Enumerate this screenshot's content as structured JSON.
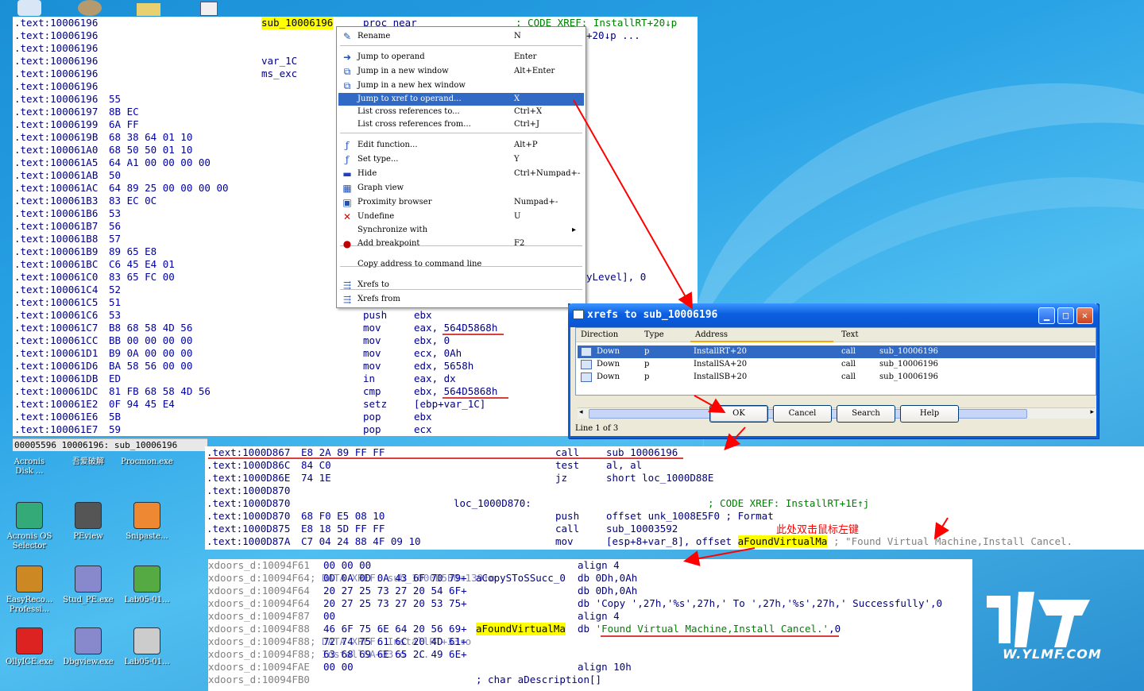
{
  "ida_view1": {
    "rows": [
      {
        "addr": ".text:10006196",
        "bytes": "",
        "label": "sub_10006196",
        "mnem": "proc near",
        "op": "; CODE XREF: InstallRT+20↓p"
      },
      {
        "addr": ".text:10006196",
        "bytes": "",
        "label": "",
        "mnem": "",
        "op": "+20↓p ..."
      },
      {
        "addr": ".text:10006196",
        "bytes": "",
        "label": "",
        "mnem": "",
        "op": ""
      },
      {
        "addr": ".text:10006196",
        "bytes": "",
        "label": "var_1C",
        "mnem": "",
        "op": ""
      },
      {
        "addr": ".text:10006196",
        "bytes": "",
        "label": "ms_exc",
        "mnem": "",
        "op": ""
      },
      {
        "addr": ".text:10006196",
        "bytes": "",
        "label": "",
        "mnem": "",
        "op": ""
      },
      {
        "addr": ".text:10006196",
        "bytes": "55",
        "label": "",
        "mnem": "",
        "op": ""
      },
      {
        "addr": ".text:10006197",
        "bytes": "8B EC",
        "label": "",
        "mnem": "",
        "op": ""
      },
      {
        "addr": ".text:10006199",
        "bytes": "6A FF",
        "label": "",
        "mnem": "",
        "op": ""
      },
      {
        "addr": ".text:1000619B",
        "bytes": "68 38 64 01 10",
        "label": "",
        "mnem": "",
        "op": ""
      },
      {
        "addr": ".text:100061A0",
        "bytes": "68 50 50 01 10",
        "label": "",
        "mnem": "",
        "op": ""
      },
      {
        "addr": ".text:100061A5",
        "bytes": "64 A1 00 00 00 00",
        "label": "",
        "mnem": "",
        "op": ""
      },
      {
        "addr": ".text:100061AB",
        "bytes": "50",
        "label": "",
        "mnem": "",
        "op": ""
      },
      {
        "addr": ".text:100061AC",
        "bytes": "64 89 25 00 00 00 00",
        "label": "",
        "mnem": "",
        "op": ""
      },
      {
        "addr": ".text:100061B3",
        "bytes": "83 EC 0C",
        "label": "",
        "mnem": "",
        "op": ""
      },
      {
        "addr": ".text:100061B6",
        "bytes": "53",
        "label": "",
        "mnem": "",
        "op": ""
      },
      {
        "addr": ".text:100061B7",
        "bytes": "56",
        "label": "",
        "mnem": "",
        "op": ""
      },
      {
        "addr": ".text:100061B8",
        "bytes": "57",
        "label": "",
        "mnem": "",
        "op": ""
      },
      {
        "addr": ".text:100061B9",
        "bytes": "89 65 E8",
        "label": "",
        "mnem": "",
        "op": ""
      },
      {
        "addr": ".text:100061BC",
        "bytes": "C6 45 E4 01",
        "label": "",
        "mnem": "",
        "op": ""
      },
      {
        "addr": ".text:100061C0",
        "bytes": "83 65 FC 00",
        "label": "",
        "mnem": "",
        "op": "yLevel], 0"
      },
      {
        "addr": ".text:100061C4",
        "bytes": "52",
        "label": "",
        "mnem": "",
        "op": ""
      },
      {
        "addr": ".text:100061C5",
        "bytes": "51",
        "label": "",
        "mnem": "",
        "op": ""
      },
      {
        "addr": ".text:100061C6",
        "bytes": "53",
        "label": "",
        "mnem": "push",
        "op": "ebx"
      },
      {
        "addr": ".text:100061C7",
        "bytes": "B8 68 58 4D 56",
        "label": "",
        "mnem": "mov",
        "op": "eax, 564D5868h"
      },
      {
        "addr": ".text:100061CC",
        "bytes": "BB 00 00 00 00",
        "label": "",
        "mnem": "mov",
        "op": "ebx, 0"
      },
      {
        "addr": ".text:100061D1",
        "bytes": "B9 0A 00 00 00",
        "label": "",
        "mnem": "mov",
        "op": "ecx, 0Ah"
      },
      {
        "addr": ".text:100061D6",
        "bytes": "BA 58 56 00 00",
        "label": "",
        "mnem": "mov",
        "op": "edx, 5658h"
      },
      {
        "addr": ".text:100061DB",
        "bytes": "ED",
        "label": "",
        "mnem": "in",
        "op": "eax, dx"
      },
      {
        "addr": ".text:100061DC",
        "bytes": "81 FB 68 58 4D 56",
        "label": "",
        "mnem": "cmp",
        "op": "ebx, 564D5868h"
      },
      {
        "addr": ".text:100061E2",
        "bytes": "0F 94 45 E4",
        "label": "",
        "mnem": "setz",
        "op": "[ebp+var_1C]"
      },
      {
        "addr": ".text:100061E6",
        "bytes": "5B",
        "label": "",
        "mnem": "pop",
        "op": "ebx"
      },
      {
        "addr": ".text:100061E7",
        "bytes": "59",
        "label": "",
        "mnem": "pop",
        "op": "ecx"
      }
    ],
    "status": "00005596 10006196: sub_10006196"
  },
  "context_menu": {
    "items": [
      {
        "label": "Rename",
        "key": "N",
        "icon": "rename-icon"
      },
      {
        "label": "Jump to operand",
        "key": "Enter",
        "icon": "jump-icon"
      },
      {
        "label": "Jump in a new window",
        "key": "Alt+Enter",
        "icon": "new-window-icon"
      },
      {
        "label": "Jump in a new hex window",
        "key": "",
        "icon": "hex-window-icon"
      },
      {
        "label": "Jump to xref to operand...",
        "key": "X",
        "icon": "",
        "selected": true
      },
      {
        "label": "List cross references to...",
        "key": "Ctrl+X",
        "icon": ""
      },
      {
        "label": "List cross references from...",
        "key": "Ctrl+J",
        "icon": ""
      },
      {
        "label": "Edit function...",
        "key": "Alt+P",
        "icon": "function-icon"
      },
      {
        "label": "Set type...",
        "key": "Y",
        "icon": "type-icon"
      },
      {
        "label": "Hide",
        "key": "Ctrl+Numpad+-",
        "icon": "hide-icon"
      },
      {
        "label": "Graph view",
        "key": "",
        "icon": "graph-icon"
      },
      {
        "label": "Proximity browser",
        "key": "Numpad+-",
        "icon": "proximity-icon"
      },
      {
        "label": "Undefine",
        "key": "U",
        "icon": "undefine-icon"
      },
      {
        "label": "Synchronize with",
        "key": "▸",
        "icon": ""
      },
      {
        "label": "Add breakpoint",
        "key": "F2",
        "icon": "breakpoint-icon"
      },
      {
        "label": "Copy address to command line",
        "key": "",
        "icon": ""
      },
      {
        "label": "Xrefs to",
        "key": "",
        "icon": "xrefs-to-icon"
      },
      {
        "label": "Xrefs from",
        "key": "",
        "icon": "xrefs-from-icon"
      }
    ]
  },
  "xrefs_dialog": {
    "title": "xrefs to sub_10006196",
    "columns": [
      "Direction",
      "Type",
      "Address",
      "Text"
    ],
    "rows": [
      {
        "direction": "Down",
        "type": "p",
        "address": "InstallRT+20",
        "text1": "call",
        "text2": "sub_10006196"
      },
      {
        "direction": "Down",
        "type": "p",
        "address": "InstallSA+20",
        "text1": "call",
        "text2": "sub_10006196"
      },
      {
        "direction": "Down",
        "type": "p",
        "address": "InstallSB+20",
        "text1": "call",
        "text2": "sub_10006196"
      }
    ],
    "buttons": {
      "ok": "OK",
      "cancel": "Cancel",
      "search": "Search",
      "help": "Help"
    },
    "status": "Line 1 of 3"
  },
  "ida_view2": {
    "rows": [
      {
        "addr": ".text:1000D867",
        "bytes": "E8 2A 89 FF FF",
        "label": "",
        "mnem": "call",
        "op": "sub_10006196",
        "comment": ""
      },
      {
        "addr": ".text:1000D86C",
        "bytes": "84 C0",
        "label": "",
        "mnem": "test",
        "op": "al, al",
        "comment": ""
      },
      {
        "addr": ".text:1000D86E",
        "bytes": "74 1E",
        "label": "",
        "mnem": "jz",
        "op": "short loc_1000D88E",
        "comment": ""
      },
      {
        "addr": ".text:1000D870",
        "bytes": "",
        "label": "",
        "mnem": "",
        "op": "",
        "comment": ""
      },
      {
        "addr": ".text:1000D870",
        "bytes": "",
        "label": "loc_1000D870:",
        "mnem": "",
        "op": "",
        "comment": "; CODE XREF: InstallRT+1E↑j"
      },
      {
        "addr": ".text:1000D870",
        "bytes": "68 F0 E5 08 10",
        "label": "",
        "mnem": "push",
        "op": "offset unk_1008E5F0 ; Format",
        "comment": ""
      },
      {
        "addr": ".text:1000D875",
        "bytes": "E8 18 5D FF FF",
        "label": "",
        "mnem": "call",
        "op": "sub_10003592",
        "comment": ""
      },
      {
        "addr": ".text:1000D87A",
        "bytes": "C7 04 24 88 4F 09 10",
        "label": "",
        "mnem": "mov",
        "op": "[esp+8+var_8], offset ",
        "op_hl": "aFoundVirtualMa",
        "comment": "; \"Found Virtual Machine,Install Cancel."
      }
    ]
  },
  "annotation": "此处双击鼠标左键",
  "ida_view3": {
    "rows": [
      {
        "addr": "xdoors_d:10094F61",
        "bytes": "00 00 00",
        "label": "",
        "mnem": "align 4",
        "op": "",
        "comment": ""
      },
      {
        "addr": "xdoors_d:10094F64",
        "bytes": "0D 0A 0D 0A 43 6F 70 79+",
        "label": "aCopySToSSucc_0",
        "mnem": "db 0Dh,0Ah",
        "op": "",
        "comment": "; DATA XREF: sub_1000D5B0+139↑o"
      },
      {
        "addr": "xdoors_d:10094F64",
        "bytes": "20 27 25 73 27 20 54 6F+",
        "label": "",
        "mnem": "db 0Dh,0Ah",
        "op": "",
        "comment": ""
      },
      {
        "addr": "xdoors_d:10094F64",
        "bytes": "20 27 25 73 27 20 53 75+",
        "label": "",
        "mnem": "db 'Copy ',27h,'%s',27h,' To ',27h,'%s',27h,' Successfully',0",
        "op": "",
        "comment": ""
      },
      {
        "addr": "xdoors_d:10094F87",
        "bytes": "00",
        "label": "",
        "mnem": "align 4",
        "op": "",
        "comment": ""
      },
      {
        "addr": "xdoors_d:10094F88",
        "bytes": "46 6F 75 6E 64 20 56 69+",
        "label": "aFoundVirtualMa",
        "mnem": "db ",
        "op": "'Found Virtual Machine,Install Cancel.'",
        "tail": ",0",
        "comment": ""
      },
      {
        "addr": "xdoors_d:10094F88",
        "bytes": "72 74 75 61 6C 20 4D 61+",
        "label": "",
        "mnem": "",
        "op": "",
        "comment": "; DATA XREF: InstallRT+33↑o"
      },
      {
        "addr": "xdoors_d:10094F88",
        "bytes": "63 68 69 6E 65 2C 49 6E+",
        "label": "",
        "mnem": "",
        "op": "",
        "comment": "; InstallSA+33↑o ..."
      },
      {
        "addr": "xdoors_d:10094FAE",
        "bytes": "00 00",
        "label": "",
        "mnem": "align 10h",
        "op": "",
        "comment": ""
      },
      {
        "addr": "xdoors_d:10094FB0",
        "bytes": "",
        "label": "; char aDescription[]",
        "mnem": "",
        "op": "",
        "comment": ""
      }
    ]
  },
  "desktop_icons": [
    {
      "label": "Acronis\nDisk ...",
      "icon": "acronis-disk-icon"
    },
    {
      "label": "吾爱破解",
      "icon": "52pojie-icon"
    },
    {
      "label": "Procmon.exe",
      "icon": "procmon-icon"
    },
    {
      "label": "Acronis OS\nSelector",
      "icon": "acronis-os-icon"
    },
    {
      "label": "PEview",
      "icon": "peview-icon"
    },
    {
      "label": "Snipaste...",
      "icon": "snipaste-icon"
    },
    {
      "label": "EasyReco...\nProfessi...",
      "icon": "easyrecovery-icon"
    },
    {
      "label": "Stud_PE.exe",
      "icon": "studpe-icon"
    },
    {
      "label": "Lab05-01...",
      "icon": "lab-dll-icon"
    },
    {
      "label": "OllyICE.exe",
      "icon": "ollyice-icon"
    },
    {
      "label": "Dbgview.exe",
      "icon": "dbgview-icon"
    },
    {
      "label": "Lab05-01...",
      "icon": "lab-file-icon"
    }
  ],
  "watermark": "W.YLMF.COM",
  "colors": {
    "accent": "#316ac5",
    "annotation": "#ff0000",
    "highlight": "#ffff00",
    "ida_code": "#000080",
    "ida_comment": "#008000"
  }
}
